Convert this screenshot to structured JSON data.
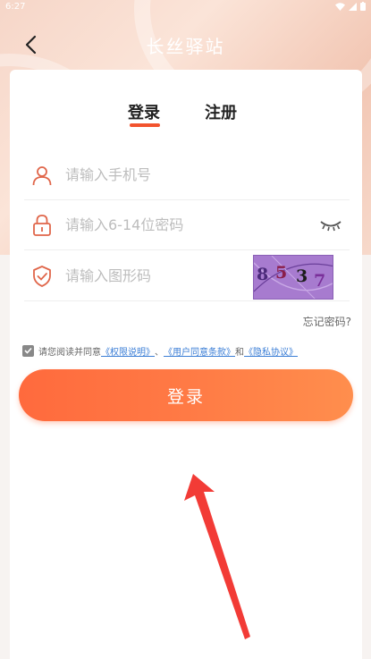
{
  "status_bar": {
    "time": "6:27"
  },
  "header": {
    "title": "长丝驿站"
  },
  "tabs": [
    {
      "label": "登录",
      "active": true
    },
    {
      "label": "注册",
      "active": false
    }
  ],
  "form": {
    "phone": {
      "placeholder": "请输入手机号",
      "value": ""
    },
    "password": {
      "placeholder": "请输入6-14位密码",
      "value": ""
    },
    "captcha_input": {
      "placeholder": "请输入图形码",
      "value": ""
    },
    "captcha_chars": [
      "8",
      "5",
      "3",
      "7"
    ]
  },
  "forgot_password": "忘记密码?",
  "agreement": {
    "checked": true,
    "prefix": "请您阅读并同意",
    "link1": "《权限说明》",
    "sep1": "、",
    "link2": "《用户同意条款》",
    "sep2": "和",
    "link3": "《隐私协议》"
  },
  "login_button": "登录",
  "colors": {
    "accent": "#f2532e",
    "button_start": "#ff6a3d",
    "button_end": "#ff8e4d",
    "icon": "#e0664a",
    "link": "#3b7ed6"
  }
}
